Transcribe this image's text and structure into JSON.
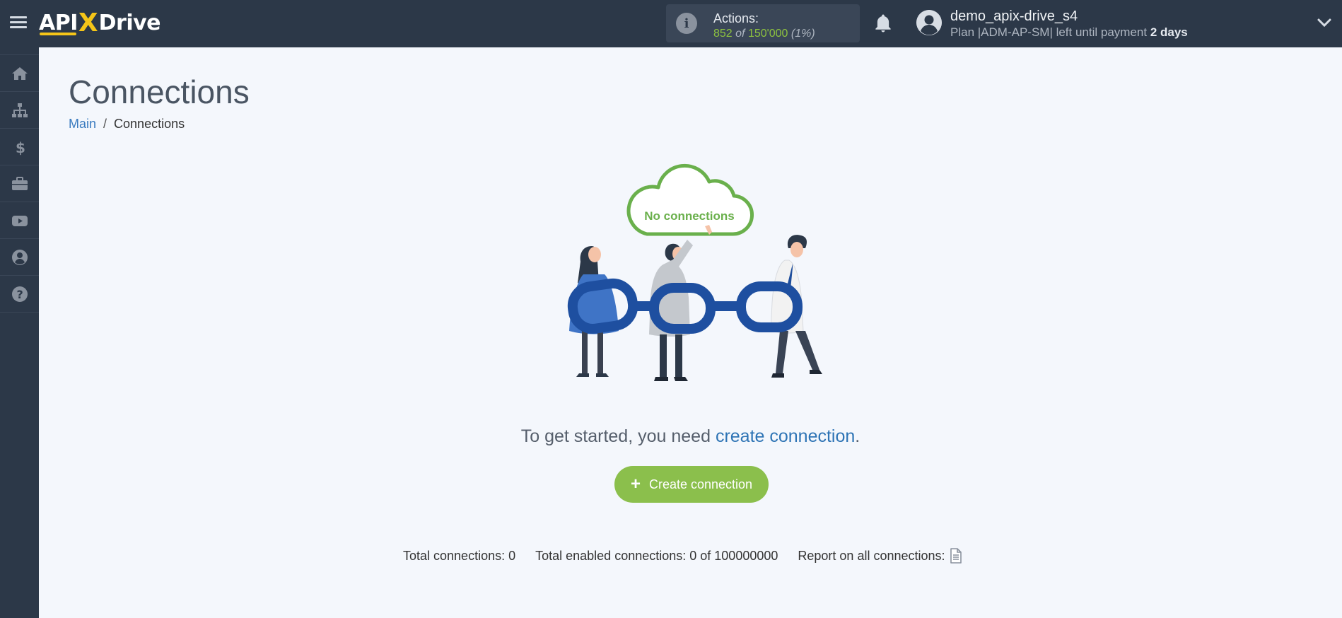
{
  "brand": {
    "logo_left": "API",
    "logo_x": "X",
    "logo_right": "Drive"
  },
  "header": {
    "actions_label": "Actions:",
    "actions_used": "852",
    "actions_of": "of",
    "actions_total": "150'000",
    "actions_percent": "(1%)",
    "username": "demo_apix-drive_s4",
    "plan_text": "Plan |ADM-AP-SM| left until payment",
    "plan_days": "2 days"
  },
  "sidebar": {
    "items": [
      {
        "name": "home",
        "icon": "home-icon"
      },
      {
        "name": "connections",
        "icon": "sitemap-icon"
      },
      {
        "name": "billing",
        "icon": "dollar-icon"
      },
      {
        "name": "services",
        "icon": "briefcase-icon"
      },
      {
        "name": "video",
        "icon": "youtube-icon"
      },
      {
        "name": "account",
        "icon": "user-circle-icon"
      },
      {
        "name": "help",
        "icon": "question-icon"
      }
    ]
  },
  "page": {
    "title": "Connections",
    "breadcrumb": {
      "main": "Main",
      "sep": "/",
      "current": "Connections"
    },
    "cloud_text": "No connections",
    "cta_prefix": "To get started, you need",
    "cta_link": "create connection",
    "cta_suffix": ".",
    "create_button": "Create connection",
    "create_plus": "+",
    "stats": {
      "total": "Total connections: 0",
      "enabled": "Total enabled connections: 0 of 100000000",
      "report": "Report on all connections:"
    }
  },
  "colors": {
    "topbar": "#2c3848",
    "accent_green": "#8bbf4c",
    "link_blue": "#2e74b5",
    "logo_yellow": "#f5c518"
  }
}
